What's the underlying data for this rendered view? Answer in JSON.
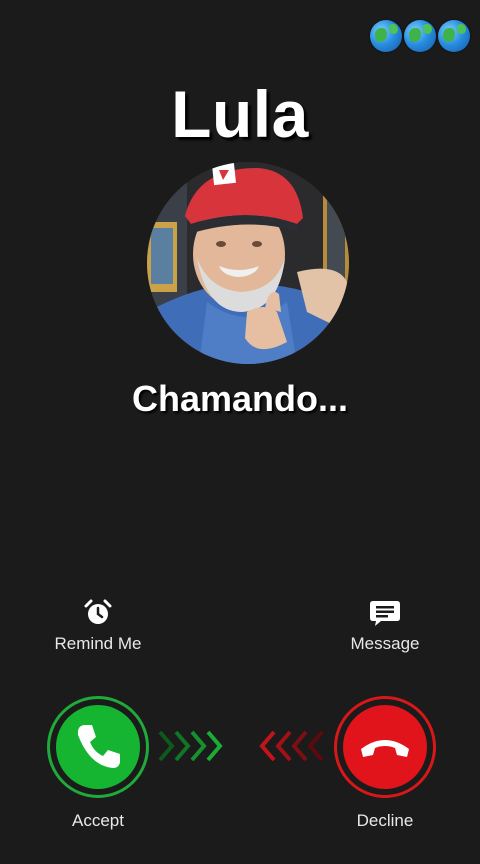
{
  "caller": {
    "name": "Lula",
    "status": "Chamando..."
  },
  "actions": {
    "remind_label": "Remind Me",
    "message_label": "Message"
  },
  "buttons": {
    "accept_label": "Accept",
    "decline_label": "Decline"
  },
  "colors": {
    "background": "#1b1b1b",
    "accept": "#15b532",
    "decline": "#e0141a"
  },
  "icons": [
    "globe-icon",
    "alarm-clock-icon",
    "message-icon",
    "phone-icon",
    "phone-hangup-icon",
    "chevron-right-icon",
    "chevron-left-icon"
  ]
}
